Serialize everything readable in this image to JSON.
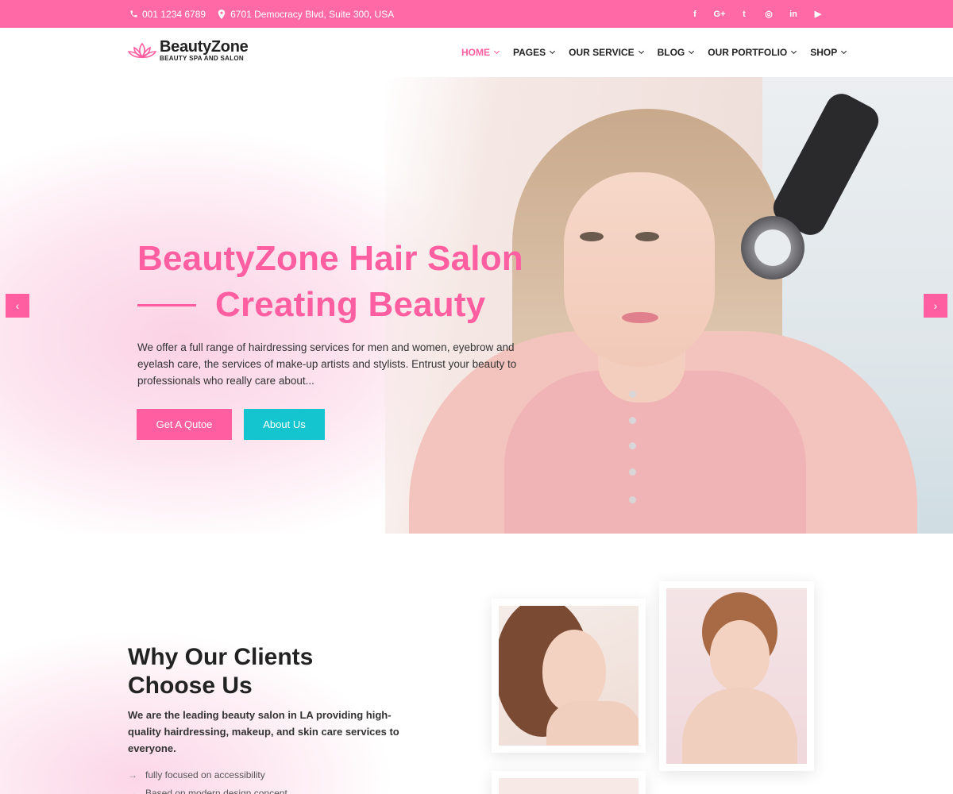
{
  "topbar": {
    "phone": "001 1234 6789",
    "address": "6701 Democracy Blvd, Suite 300, USA",
    "social": [
      {
        "icon": "facebook-icon",
        "glyph": "f"
      },
      {
        "icon": "google-plus-icon",
        "glyph": "G+"
      },
      {
        "icon": "twitter-icon",
        "glyph": "t"
      },
      {
        "icon": "instagram-icon",
        "glyph": "◎"
      },
      {
        "icon": "linkedin-icon",
        "glyph": "in"
      },
      {
        "icon": "youtube-icon",
        "glyph": "▶"
      }
    ]
  },
  "header": {
    "brand": "BeautyZone",
    "tagline": "BEAUTY SPA AND SALON",
    "nav": [
      "HOME",
      "PAGES",
      "OUR SERVICE",
      "BLOG",
      "OUR PORTFOLIO",
      "SHOP"
    ],
    "active_nav": "HOME"
  },
  "hero": {
    "title_line1": "BeautyZone Hair Salon",
    "title_line2": "Creating Beauty",
    "description": "We offer a full range of hairdressing services for men and women, eyebrow and eyelash care, the services of make-up artists and stylists. Entrust your beauty to professionals who really care about...",
    "btn_quote": "Get A Qutoe",
    "btn_about": "About Us",
    "prev_glyph": "‹",
    "next_glyph": "›"
  },
  "why": {
    "heading_line1": "Why Our Clients",
    "heading_line2": "Choose Us",
    "lead": "We are the leading beauty salon in LA providing high-quality hairdressing, makeup, and skin care services to everyone.",
    "features": [
      "fully focused on accessibility",
      "Based on modern design concept"
    ]
  },
  "colors": {
    "primary_pink": "#ff5ea0",
    "topbar_pink": "#ff6aa6",
    "teal": "#14c4cf"
  }
}
